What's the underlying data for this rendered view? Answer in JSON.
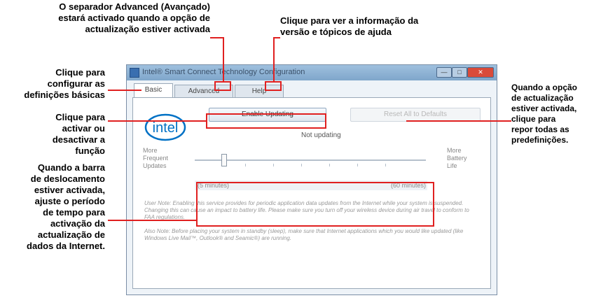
{
  "callouts": {
    "advanced_tab": "O separador Advanced (Avançado)\nestará activado quando a opção de\nactualização  estiver activada",
    "help_tab": "Clique para ver a informação da\nversão e tópicos de ajuda",
    "basic_tab": "Clique para\nconfigurar as\ndefinições básicas",
    "enable_button": "Clique para\nactivar ou\ndesactivar a\nfunção",
    "slider": "Quando a barra\nde deslocamento\nestiver activada,\najuste o período\nde tempo para\nactivação da\nactualização de\ndados da Internet.",
    "reset_button": "Quando a opção\nde actualização\nestiver activada,\nclique para\nrepor todas as\npredefinições."
  },
  "window": {
    "title": "Intel® Smart Connect Technology Configuration",
    "tabs": [
      {
        "label": "Basic"
      },
      {
        "label": "Advanced"
      },
      {
        "label": "Help"
      }
    ],
    "enable_button": "Enable Updating",
    "reset_button": "Reset All to Defaults",
    "status": "Not updating",
    "logo_text": "intel",
    "left_label": "More\nFrequent\nUpdates",
    "right_label": "More\nBattery\nLife",
    "min_value": "(5 minutes)",
    "max_value": "(60 minutes)",
    "note1": "User Note: Enabling this service provides for periodic application data updates from the Internet while your system is suspended. Changing this can cause an impact to battery life. Please make sure you turn off your wireless device during air travel to conform to FAA regulations.",
    "note2": "Also Note: Before placing your system in standby (sleep), make sure that Internet applications which you would like updated (like Windows Live Mail™, Outlook® and Seamic®) are running."
  },
  "colors": {
    "accent": "#e02020",
    "intel_blue": "#0071c5"
  }
}
